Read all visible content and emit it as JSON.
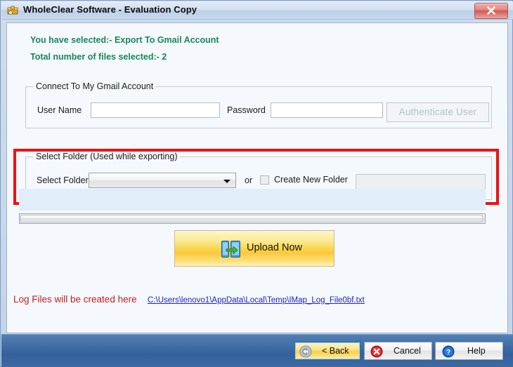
{
  "window": {
    "title": "WholeClear Software - Evaluation Copy",
    "app_icon": "package-icon",
    "close_label": "close-icon"
  },
  "status": {
    "selected_line": "You have selected:- Export  To Gmail Account",
    "files_line": "Total number of files selected:- 2"
  },
  "gmail_group": {
    "title": "Connect To My Gmail Account",
    "username_label": "User Name",
    "username_value": "",
    "password_label": "Password",
    "password_value": "",
    "authenticate_label": "Authenticate User"
  },
  "folder_group": {
    "title": "Select Folder (Used while exporting)",
    "select_label": "Select Folder",
    "selected_folder": "",
    "or_label": "or",
    "create_new_label": "Create New Folder",
    "create_new_value": "",
    "create_new_checked": false
  },
  "upload": {
    "label": "Upload Now",
    "icon": "upload-transfer-icon"
  },
  "log": {
    "text": "Log Files will be created here",
    "path": "C:\\Users\\lenovo1\\AppData\\Local\\Temp\\IMap_Log_File0bf.txt"
  },
  "footer": {
    "back_label": "< Back",
    "back_icon": "rewind-icon",
    "cancel_label": "Cancel",
    "cancel_icon": "error-x-icon",
    "help_label": "Help",
    "help_icon": "question-mark-icon"
  },
  "colors": {
    "status_green": "#17875a",
    "highlight_red": "#ee1111",
    "log_red": "#c32020",
    "link_blue": "#2222cc",
    "footer_blue": "#406ea6",
    "upload_yellow": "#f9d44a"
  },
  "progress": {
    "scroll_position": 0
  }
}
